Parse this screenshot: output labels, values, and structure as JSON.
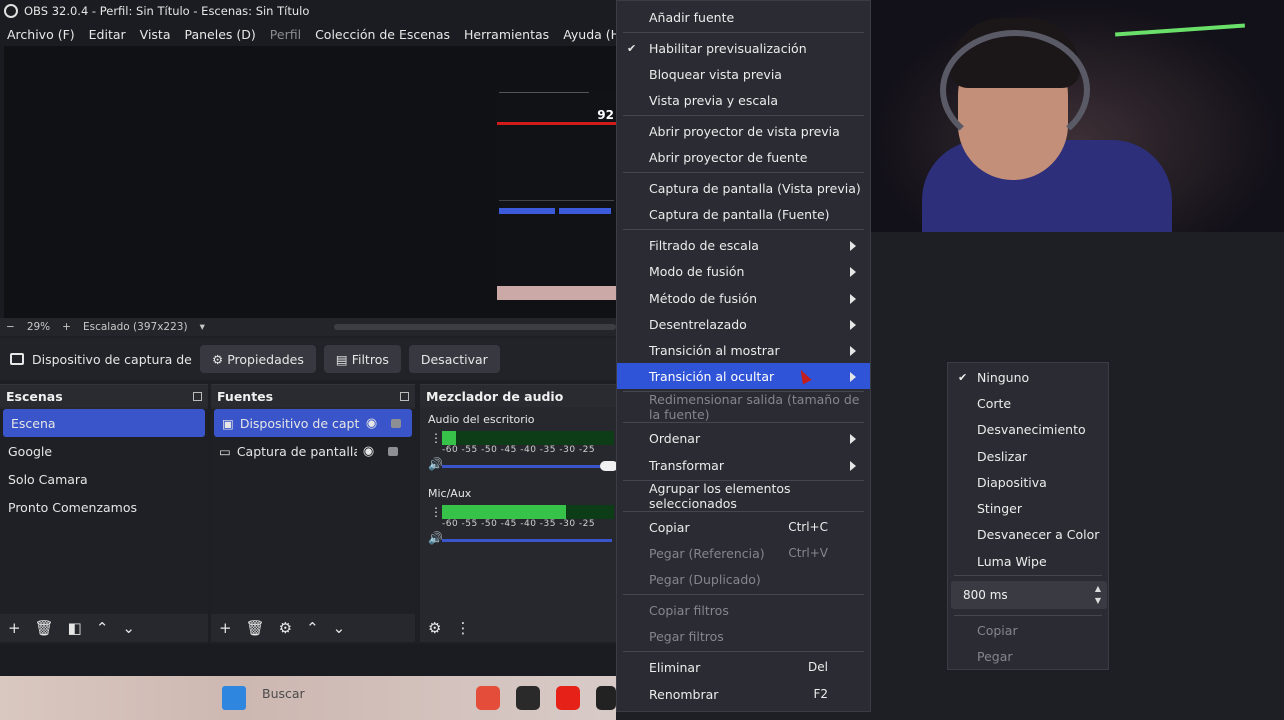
{
  "window": {
    "title": "OBS 32.0.4 - Perfil: Sin Título - Escenas: Sin Título"
  },
  "menubar": {
    "items": [
      "Archivo (F)",
      "Editar",
      "Vista",
      "Paneles (D)",
      "Perfil",
      "Colección de Escenas",
      "Herramientas",
      "Ayuda (H)"
    ]
  },
  "zoombar": {
    "minus": "−",
    "zoom": "29%",
    "plus": "+",
    "scale": "Escalado (397x223)"
  },
  "source_toolbar": {
    "source_name": "Dispositivo de captura de v",
    "properties": "Propiedades",
    "filters": "Filtros",
    "deactivate": "Desactivar"
  },
  "scenes": {
    "title": "Escenas",
    "items": [
      "Escena",
      "Google",
      "Solo Camara",
      "Pronto Comenzamos"
    ]
  },
  "sources": {
    "title": "Fuentes",
    "items": [
      "Dispositivo de captur",
      "Captura de pantalla"
    ]
  },
  "mixer": {
    "title": "Mezclador de audio",
    "channels": [
      {
        "name": "Audio del escritorio",
        "level": 0.08,
        "volume": 1.0
      },
      {
        "name": "Mic/Aux",
        "level": 0.72,
        "volume": 1.0
      }
    ],
    "ticks": "-60 -55 -50 -45 -40 -35 -30 -25"
  },
  "taskbar": {
    "search": "Buscar"
  },
  "context_menu": {
    "items": [
      {
        "label": "Añadir fuente"
      },
      {
        "label": "Habilitar previsualización",
        "checked": true
      },
      {
        "label": "Bloquear vista previa"
      },
      {
        "label": "Vista previa y escala"
      },
      {
        "label": "Abrir proyector de vista previa"
      },
      {
        "label": "Abrir proyector de fuente"
      },
      {
        "label": "Captura de pantalla (Vista previa)"
      },
      {
        "label": "Captura de pantalla (Fuente)"
      },
      {
        "label": "Filtrado de escala",
        "submenu": true
      },
      {
        "label": "Modo de fusión",
        "submenu": true
      },
      {
        "label": "Método de fusión",
        "submenu": true
      },
      {
        "label": "Desentrelazado",
        "submenu": true
      },
      {
        "label": "Transición al mostrar",
        "submenu": true
      },
      {
        "label": "Transición al ocultar",
        "submenu": true,
        "highlighted": true
      },
      {
        "label": "Redimensionar salida (tamaño de la fuente)",
        "disabled": true
      },
      {
        "label": "Ordenar",
        "submenu": true
      },
      {
        "label": "Transformar",
        "submenu": true
      },
      {
        "label": "Agrupar los elementos seleccionados"
      },
      {
        "label": "Copiar",
        "shortcut": "Ctrl+C"
      },
      {
        "label": "Pegar (Referencia)",
        "shortcut": "Ctrl+V",
        "disabled": true
      },
      {
        "label": "Pegar (Duplicado)",
        "disabled": true
      },
      {
        "label": "Copiar filtros",
        "disabled": true
      },
      {
        "label": "Pegar filtros",
        "disabled": true
      },
      {
        "label": "Eliminar",
        "shortcut": "Del"
      },
      {
        "label": "Renombrar",
        "shortcut": "F2"
      }
    ]
  },
  "transition_submenu": {
    "items": [
      {
        "label": "Ninguno",
        "checked": true
      },
      {
        "label": "Corte"
      },
      {
        "label": "Desvanecimiento"
      },
      {
        "label": "Deslizar"
      },
      {
        "label": "Diapositiva"
      },
      {
        "label": "Stinger"
      },
      {
        "label": "Desvanecer a Color"
      },
      {
        "label": "Luma Wipe"
      }
    ],
    "duration": "800 ms",
    "copy": "Copiar",
    "paste": "Pegar"
  },
  "preview": {
    "mini_number": "92"
  },
  "colors": {
    "accent": "#2f54d8",
    "meter_green": "#37c24a",
    "menu_bg": "#2b2c33"
  }
}
